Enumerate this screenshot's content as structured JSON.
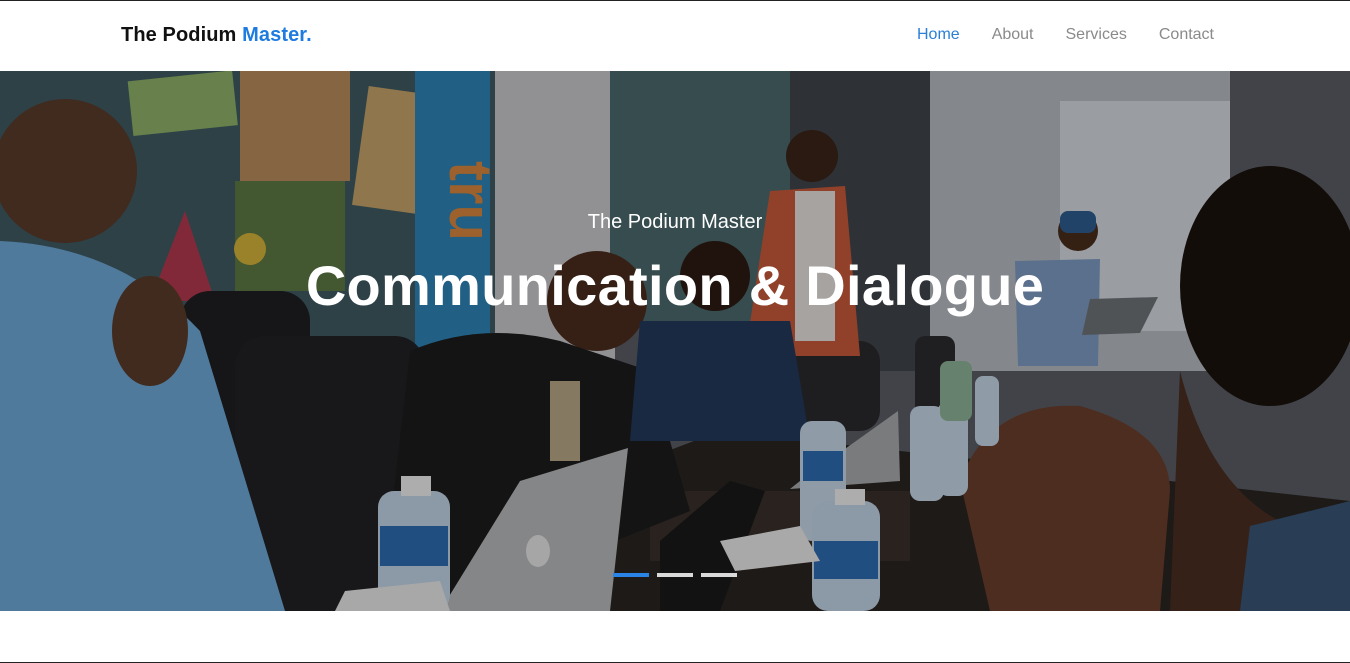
{
  "navbar": {
    "brand_main": "The Podium ",
    "brand_accent": "Master.",
    "links": [
      {
        "label": "Home",
        "active": true
      },
      {
        "label": "About",
        "active": false
      },
      {
        "label": "Services",
        "active": false
      },
      {
        "label": "Contact",
        "active": false
      }
    ]
  },
  "hero": {
    "subtitle": "The Podium Master",
    "title": "Communication & Dialogue",
    "image": "meeting-room-photo",
    "slides_total": 3,
    "active_slide": 1
  },
  "colors": {
    "accent": "#1e7be0",
    "nav_active": "#2a7fd6",
    "nav_inactive": "#8a8a8a",
    "indicator_active": "#2a84e6",
    "indicator_inactive": "#d9d9d9"
  }
}
